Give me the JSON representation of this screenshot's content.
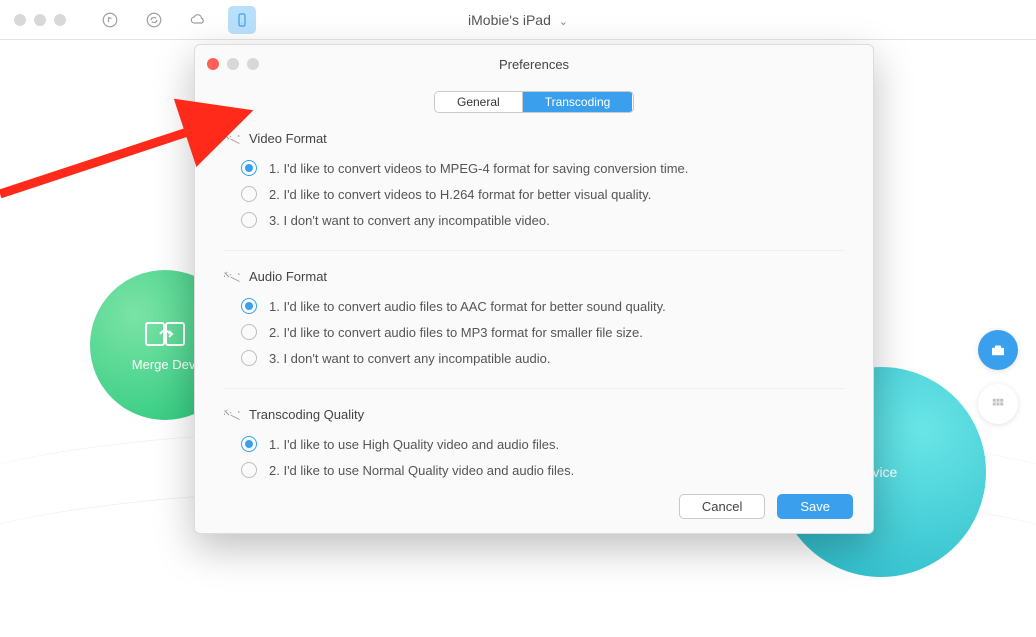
{
  "toolbar": {
    "device_title": "iMobie's iPad",
    "icons": [
      "music-icon",
      "sync-icon",
      "cloud-icon",
      "device-icon"
    ]
  },
  "background": {
    "left_blob_label": "Merge Devi",
    "right_blob_label": "evice"
  },
  "side_buttons": [
    "toolbox-icon",
    "grid-icon"
  ],
  "modal": {
    "title": "Preferences",
    "tabs": [
      {
        "label": "General",
        "active": false
      },
      {
        "label": "Transcoding",
        "active": true
      }
    ],
    "sections": [
      {
        "title": "Video Format",
        "options": [
          {
            "label": "1. I'd like to convert videos to MPEG-4 format for saving conversion time.",
            "selected": true
          },
          {
            "label": "2. I'd like to convert videos to H.264 format for better visual quality.",
            "selected": false
          },
          {
            "label": "3. I don't want to convert any incompatible video.",
            "selected": false
          }
        ]
      },
      {
        "title": "Audio Format",
        "options": [
          {
            "label": "1. I'd like to convert audio files to AAC format for better sound quality.",
            "selected": true
          },
          {
            "label": "2. I'd like to convert audio files to MP3 format for smaller file size.",
            "selected": false
          },
          {
            "label": "3. I don't want to convert any incompatible audio.",
            "selected": false
          }
        ]
      },
      {
        "title": "Transcoding Quality",
        "options": [
          {
            "label": "1. I'd like to use High Quality video and audio files.",
            "selected": true
          },
          {
            "label": "2. I'd like to use Normal Quality video and audio files.",
            "selected": false
          }
        ]
      }
    ],
    "buttons": {
      "cancel": "Cancel",
      "save": "Save"
    }
  }
}
